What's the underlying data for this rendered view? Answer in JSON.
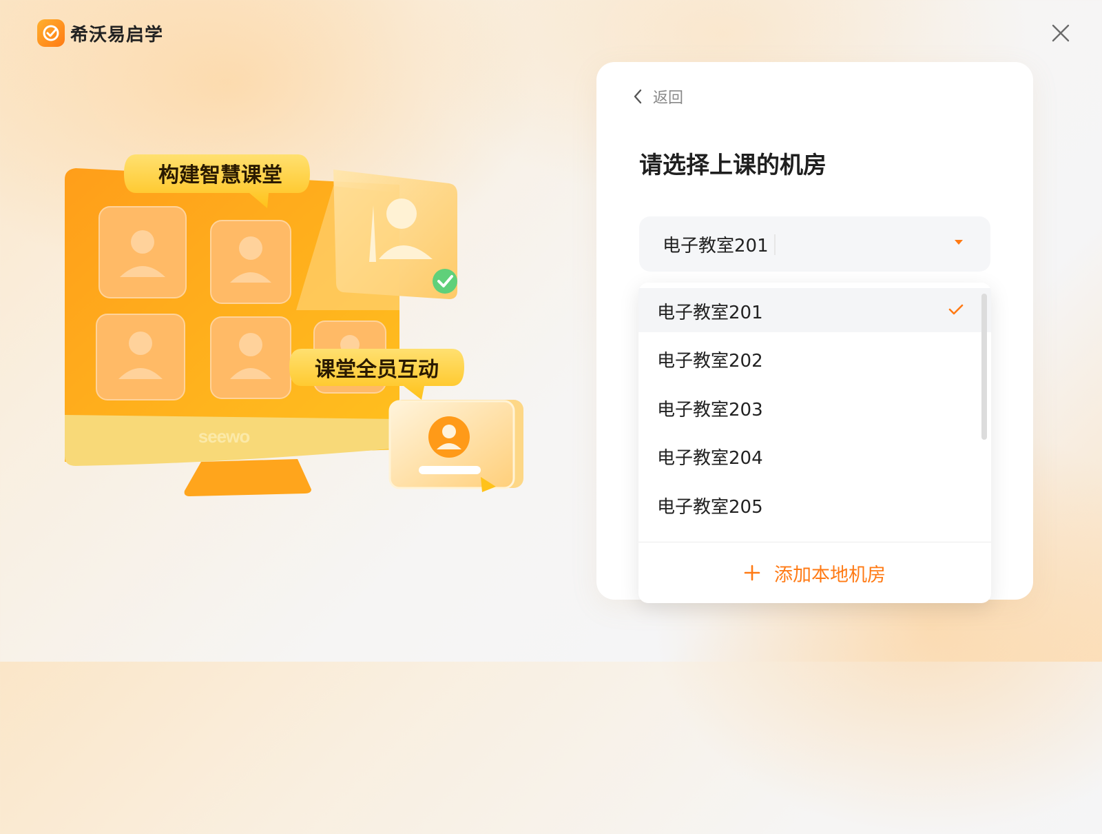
{
  "app": {
    "name": "希沃易启学"
  },
  "illustration": {
    "bubble_top": "构建智慧课堂",
    "bubble_bottom": "课堂全员互动",
    "brand_mark": "seewo"
  },
  "panel": {
    "back_label": "返回",
    "title": "请选择上课的机房",
    "select": {
      "value": "电子教室201"
    },
    "options": [
      {
        "label": "电子教室201",
        "selected": true
      },
      {
        "label": "电子教室202",
        "selected": false
      },
      {
        "label": "电子教室203",
        "selected": false
      },
      {
        "label": "电子教室204",
        "selected": false
      },
      {
        "label": "电子教室205",
        "selected": false
      }
    ],
    "add_label": "添加本地机房"
  },
  "icons": {
    "logo": "app-logo-icon",
    "close": "close-icon",
    "back": "chevron-left-icon",
    "dropdown": "caret-down-icon",
    "check": "check-icon",
    "add": "plus-icon"
  },
  "colors": {
    "accent": "#ff7a14",
    "brand_gradient_start": "#ffb02e",
    "text": "#222222",
    "muted": "#888888"
  }
}
